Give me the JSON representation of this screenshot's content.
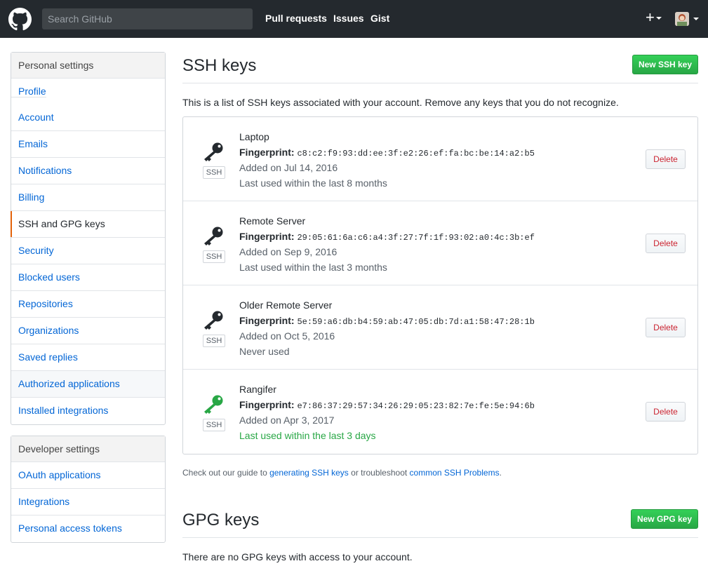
{
  "header": {
    "search_placeholder": "Search GitHub",
    "nav": [
      "Pull requests",
      "Issues",
      "Gist"
    ],
    "plus_label": "+"
  },
  "personal_settings": {
    "heading": "Personal settings",
    "items": [
      {
        "label": "Profile"
      },
      {
        "label": "Account"
      },
      {
        "label": "Emails"
      },
      {
        "label": "Notifications"
      },
      {
        "label": "Billing"
      },
      {
        "label": "SSH and GPG keys",
        "selected": true
      },
      {
        "label": "Security"
      },
      {
        "label": "Blocked users"
      },
      {
        "label": "Repositories"
      },
      {
        "label": "Organizations"
      },
      {
        "label": "Saved replies"
      },
      {
        "label": "Authorized applications"
      },
      {
        "label": "Installed integrations"
      }
    ]
  },
  "developer_settings": {
    "heading": "Developer settings",
    "items": [
      {
        "label": "OAuth applications"
      },
      {
        "label": "Integrations"
      },
      {
        "label": "Personal access tokens"
      }
    ]
  },
  "ssh": {
    "title": "SSH keys",
    "new_button": "New SSH key",
    "intro": "This is a list of SSH keys associated with your account. Remove any keys that you do not recognize.",
    "fingerprint_label": "Fingerprint:",
    "badge": "SSH",
    "delete_label": "Delete",
    "keys": [
      {
        "title": "Laptop",
        "fingerprint": "c8:c2:f9:93:dd:ee:3f:e2:26:ef:fa:bc:be:14:a2:b5",
        "added": "Added on Jul 14, 2016",
        "used": "Last used within the last 8 months",
        "recent": false
      },
      {
        "title": "Remote Server",
        "fingerprint": "29:05:61:6a:c6:a4:3f:27:7f:1f:93:02:a0:4c:3b:ef",
        "added": "Added on Sep 9, 2016",
        "used": "Last used within the last 3 months",
        "recent": false
      },
      {
        "title": "Older Remote Server",
        "fingerprint": "5e:59:a6:db:b4:59:ab:47:05:db:7d:a1:58:47:28:1b",
        "added": "Added on Oct 5, 2016",
        "used": "Never used",
        "recent": false
      },
      {
        "title": "Rangifer",
        "fingerprint": "e7:86:37:29:57:34:26:29:05:23:82:7e:fe:5e:94:6b",
        "added": "Added on Apr 3, 2017",
        "used": "Last used within the last 3 days",
        "recent": true
      }
    ],
    "help": {
      "prefix": "Check out our guide to ",
      "link1": "generating SSH keys",
      "middle": " or troubleshoot ",
      "link2": "common SSH Problems",
      "suffix": "."
    }
  },
  "gpg": {
    "title": "GPG keys",
    "new_button": "New GPG key",
    "empty": "There are no GPG keys with access to your account."
  },
  "colors": {
    "header_bg": "#24292e",
    "link": "#0366d6",
    "green": "#28a745",
    "danger": "#cb2431",
    "selected_bar": "#e36209",
    "key_inactive": "#24292e"
  }
}
